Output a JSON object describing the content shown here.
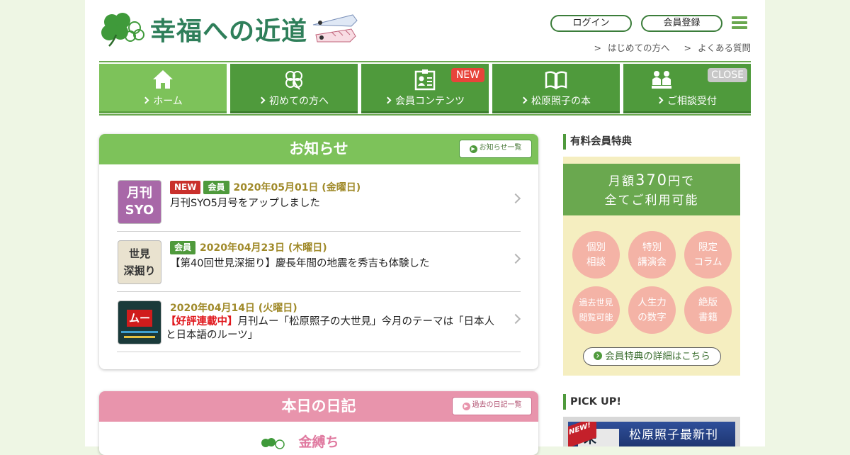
{
  "header": {
    "logo_text": "幸福への近道",
    "login_label": "ログイン",
    "register_label": "会員登録",
    "sublinks": [
      "はじめての方へ",
      "よくある質問"
    ]
  },
  "nav": {
    "items": [
      {
        "label": "ホーム",
        "icon": "home-icon"
      },
      {
        "label": "初めての方へ",
        "icon": "clover-icon"
      },
      {
        "label": "会員コンテンツ",
        "icon": "member-card-icon",
        "badge": "NEW"
      },
      {
        "label": "松原照子の本",
        "icon": "book-icon"
      },
      {
        "label": "ご相談受付",
        "icon": "consultation-icon",
        "badge": "CLOSE"
      }
    ]
  },
  "news": {
    "title": "お知らせ",
    "list_button": "お知らせ一覧",
    "items": [
      {
        "thumb_text": [
          "月刊",
          "SYO"
        ],
        "tags": [
          "NEW",
          "会員"
        ],
        "date": "2020年05月01日 (金曜日)",
        "text": "月刊SYO5月号をアップしました"
      },
      {
        "thumb_text": [
          "世見",
          "深掘り"
        ],
        "tags": [
          "会員"
        ],
        "date": "2020年04月23日 (木曜日)",
        "text": "【第40回世見深掘り】慶長年間の地震を秀吉も体験した"
      },
      {
        "thumb_text": [
          "ムー"
        ],
        "tags": [],
        "date": "2020年04月14日 (火曜日)",
        "highlight": "【好評連載中】",
        "text": "月刊ムー「松原照子の大世見」今月のテーマは「日本人と日本語のルーツ」"
      }
    ]
  },
  "diary": {
    "title": "本日の日記",
    "list_button": "過去の日記一覧",
    "subtitle": "金縛ち"
  },
  "benefits": {
    "heading": "有料会員特典",
    "price_prefix": "月額",
    "price_value": "370",
    "price_suffix": "円で",
    "price_line2": "全てご利用可能",
    "circles": [
      [
        "個別",
        "相談"
      ],
      [
        "特別",
        "講演会"
      ],
      [
        "限定",
        "コラム"
      ],
      [
        "過去世見",
        "閲覧可能"
      ],
      [
        "人生力",
        "の数字"
      ],
      [
        "絶版",
        "書籍"
      ]
    ],
    "detail_link": "会員特典の詳細はこちら"
  },
  "pickup": {
    "heading": "PICK UP!",
    "badge": "NEW!",
    "book_char": "未",
    "banner_text": "松原照子最新刊"
  },
  "colors": {
    "brand_green": "#4f9a3c",
    "light_green": "#7dc25a",
    "diary_pink": "#e894ac",
    "benefit_cream": "#f5eec0",
    "circle_pink": "#f4b3a6",
    "new_red": "#c9302c"
  }
}
